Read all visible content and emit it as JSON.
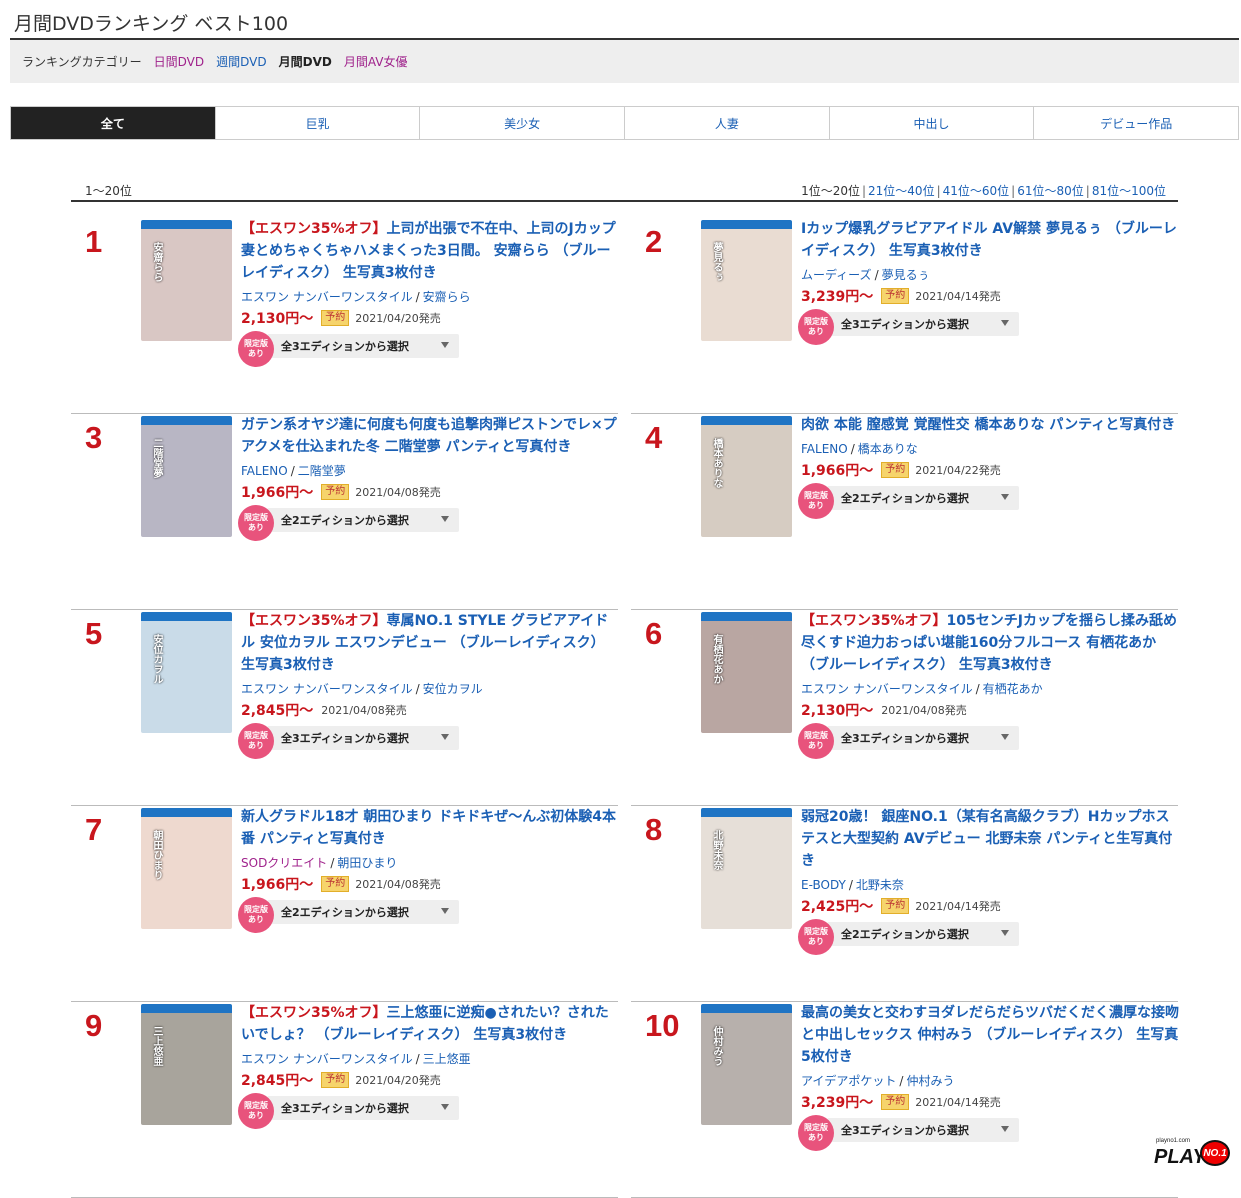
{
  "page_title": "月間DVDランキング ベスト100",
  "category_bar": {
    "label": "ランキングカテゴリー",
    "links": [
      "日間DVD",
      "週間DVD",
      "月間DVD",
      "月間AV女優"
    ]
  },
  "tabs": [
    "全て",
    "巨乳",
    "美少女",
    "人妻",
    "中出し",
    "デビュー作品"
  ],
  "pager": {
    "current_range": "1〜20位",
    "ranges": [
      "1位〜20位",
      "21位〜40位",
      "41位〜60位",
      "61位〜80位",
      "81位〜100位"
    ]
  },
  "edition_badge": "限定版\nあり",
  "reserve_label": "予約",
  "items": [
    {
      "rank": "1",
      "promo": "【エスワン35%オフ】",
      "title": "上司が出張で不在中、上司のJカップ妻とめちゃくちゃハメまくった3日間。 安齋らら （ブルーレイディスク） 生写真3枚付き",
      "maker": "エスワン ナンバーワンスタイル",
      "actress": "安齋らら",
      "price": "2,130円〜",
      "date": "2021/04/20発売",
      "reserve": true,
      "edition": "全3エディションから選択",
      "cover_color": "#d9c7c4"
    },
    {
      "rank": "2",
      "promo": "",
      "title": "Iカップ爆乳グラビアアイドル AV解禁 夢見るぅ （ブルーレイディスク） 生写真3枚付き",
      "maker": "ムーディーズ",
      "actress": "夢見るぅ",
      "price": "3,239円〜",
      "date": "2021/04/14発売",
      "reserve": true,
      "edition": "全3エディションから選択",
      "cover_color": "#e9dcd2"
    },
    {
      "rank": "3",
      "promo": "",
      "title": "ガテン系オヤジ達に何度も何度も追撃肉弾ピストンでレ×プアクメを仕込まれた冬 二階堂夢 パンティと写真付き",
      "maker": "FALENO",
      "actress": "二階堂夢",
      "price": "1,966円〜",
      "date": "2021/04/08発売",
      "reserve": true,
      "edition": "全2エディションから選択",
      "cover_color": "#b8b6c4"
    },
    {
      "rank": "4",
      "promo": "",
      "title": "肉欲 本能 膣感覚 覚醒性交 橋本ありな パンティと写真付き",
      "maker": "FALENO",
      "actress": "橋本ありな",
      "price": "1,966円〜",
      "date": "2021/04/22発売",
      "reserve": true,
      "edition": "全2エディションから選択",
      "cover_color": "#d6ccc2"
    },
    {
      "rank": "5",
      "promo": "【エスワン35%オフ】",
      "title": "専属NO.1 STYLE グラビアアイドル 安位カヲル エスワンデビュー （ブルーレイディスク） 生写真3枚付き",
      "maker": "エスワン ナンバーワンスタイル",
      "actress": "安位カヲル",
      "price": "2,845円〜",
      "date": "2021/04/08発売",
      "reserve": false,
      "edition": "全3エディションから選択",
      "cover_color": "#c9dbe8"
    },
    {
      "rank": "6",
      "promo": "【エスワン35%オフ】",
      "title": "105センチJカップを揺らし揉み舐め尽くすド迫力おっぱい堪能160分フルコース 有栖花あか （ブルーレイディスク） 生写真3枚付き",
      "maker": "エスワン ナンバーワンスタイル",
      "actress": "有栖花あか",
      "price": "2,130円〜",
      "date": "2021/04/08発売",
      "reserve": false,
      "edition": "全3エディションから選択",
      "cover_color": "#b9a6a2"
    },
    {
      "rank": "7",
      "promo": "",
      "title": "新人グラドル18才 朝田ひまり ドキドキぜ〜んぶ初体験4本番 パンティと写真付き",
      "maker": "SODクリエイト",
      "actress": "朝田ひまり",
      "price": "1,966円〜",
      "date": "2021/04/08発売",
      "reserve": true,
      "edition": "全2エディションから選択",
      "cover_color": "#eed9cf",
      "maker_purple": true
    },
    {
      "rank": "8",
      "promo": "",
      "title": "弱冠20歳！ 銀座NO.1（某有名高級クラブ）Hカップホステスと大型契約 AVデビュー 北野未奈 パンティと生写真付き",
      "maker": "E-BODY",
      "actress": "北野未奈",
      "price": "2,425円〜",
      "date": "2021/04/14発売",
      "reserve": true,
      "edition": "全2エディションから選択",
      "cover_color": "#e6dfd8"
    },
    {
      "rank": "9",
      "promo": "【エスワン35%オフ】",
      "title": "三上悠亜に逆痴●されたい？されたいでしょ？ （ブルーレイディスク） 生写真3枚付き",
      "maker": "エスワン ナンバーワンスタイル",
      "actress": "三上悠亜",
      "price": "2,845円〜",
      "date": "2021/04/20発売",
      "reserve": true,
      "edition": "全3エディションから選択",
      "cover_color": "#a8a49c"
    },
    {
      "rank": "10",
      "promo": "",
      "title": "最高の美女と交わすヨダレだらだらツバだくだく濃厚な接吻と中出しセックス 仲村みう （ブルーレイディスク） 生写真5枚付き",
      "maker": "アイデアポケット",
      "actress": "仲村みう",
      "price": "3,239円〜",
      "date": "2021/04/14発売",
      "reserve": true,
      "edition": "全3エディションから選択",
      "cover_color": "#b7b0ac"
    }
  ],
  "logo": {
    "small": "playno1.com",
    "main": "PLAY",
    "badge": "NO.1"
  }
}
